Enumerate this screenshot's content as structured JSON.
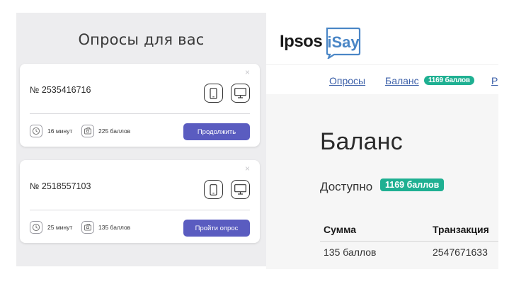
{
  "left": {
    "title": "Опросы для вас",
    "cards": [
      {
        "number": "№ 2535416716",
        "close": "×",
        "duration": "16 минут",
        "points": "225 баллов",
        "button": "Продолжить"
      },
      {
        "number": "№ 2518557103",
        "close": "×",
        "duration": "25 минут",
        "points": "135 баллов",
        "button": "Пройти опрос"
      }
    ]
  },
  "right": {
    "logo": {
      "ipsos": "Ipsos",
      "isay": "iSay"
    },
    "nav": {
      "surveys": "Опросы",
      "balance": "Баланс",
      "balance_badge": "1169 баллов",
      "more": "Р"
    },
    "title": "Баланс",
    "available_label": "Доступно",
    "available_badge": "1169 баллов",
    "table": {
      "headers": [
        "Сумма",
        "Транзакция"
      ],
      "rows": [
        [
          "135 баллов",
          "2547671633"
        ]
      ]
    }
  },
  "colors": {
    "accent_button": "#5a5cc0",
    "badge_green": "#1fb092",
    "link_blue": "#3b5fa8",
    "logo_blue": "#4a86c6"
  }
}
